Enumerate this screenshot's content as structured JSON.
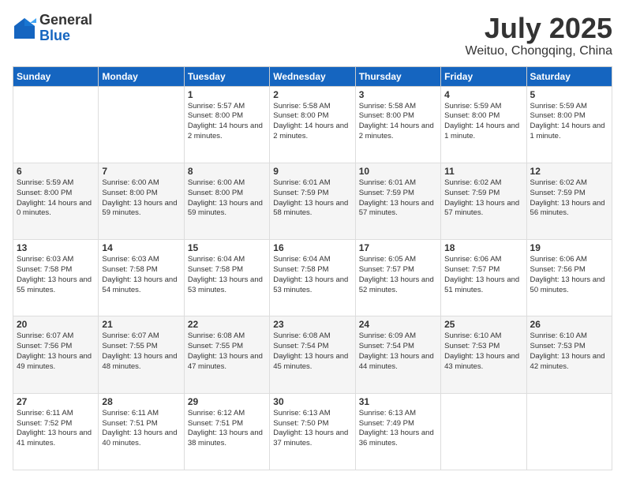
{
  "logo": {
    "general": "General",
    "blue": "Blue"
  },
  "title": "July 2025",
  "location": "Weituo, Chongqing, China",
  "weekdays": [
    "Sunday",
    "Monday",
    "Tuesday",
    "Wednesday",
    "Thursday",
    "Friday",
    "Saturday"
  ],
  "weeks": [
    [
      {
        "day": "",
        "info": ""
      },
      {
        "day": "",
        "info": ""
      },
      {
        "day": "1",
        "info": "Sunrise: 5:57 AM\nSunset: 8:00 PM\nDaylight: 14 hours and 2 minutes."
      },
      {
        "day": "2",
        "info": "Sunrise: 5:58 AM\nSunset: 8:00 PM\nDaylight: 14 hours and 2 minutes."
      },
      {
        "day": "3",
        "info": "Sunrise: 5:58 AM\nSunset: 8:00 PM\nDaylight: 14 hours and 2 minutes."
      },
      {
        "day": "4",
        "info": "Sunrise: 5:59 AM\nSunset: 8:00 PM\nDaylight: 14 hours and 1 minute."
      },
      {
        "day": "5",
        "info": "Sunrise: 5:59 AM\nSunset: 8:00 PM\nDaylight: 14 hours and 1 minute."
      }
    ],
    [
      {
        "day": "6",
        "info": "Sunrise: 5:59 AM\nSunset: 8:00 PM\nDaylight: 14 hours and 0 minutes."
      },
      {
        "day": "7",
        "info": "Sunrise: 6:00 AM\nSunset: 8:00 PM\nDaylight: 13 hours and 59 minutes."
      },
      {
        "day": "8",
        "info": "Sunrise: 6:00 AM\nSunset: 8:00 PM\nDaylight: 13 hours and 59 minutes."
      },
      {
        "day": "9",
        "info": "Sunrise: 6:01 AM\nSunset: 7:59 PM\nDaylight: 13 hours and 58 minutes."
      },
      {
        "day": "10",
        "info": "Sunrise: 6:01 AM\nSunset: 7:59 PM\nDaylight: 13 hours and 57 minutes."
      },
      {
        "day": "11",
        "info": "Sunrise: 6:02 AM\nSunset: 7:59 PM\nDaylight: 13 hours and 57 minutes."
      },
      {
        "day": "12",
        "info": "Sunrise: 6:02 AM\nSunset: 7:59 PM\nDaylight: 13 hours and 56 minutes."
      }
    ],
    [
      {
        "day": "13",
        "info": "Sunrise: 6:03 AM\nSunset: 7:58 PM\nDaylight: 13 hours and 55 minutes."
      },
      {
        "day": "14",
        "info": "Sunrise: 6:03 AM\nSunset: 7:58 PM\nDaylight: 13 hours and 54 minutes."
      },
      {
        "day": "15",
        "info": "Sunrise: 6:04 AM\nSunset: 7:58 PM\nDaylight: 13 hours and 53 minutes."
      },
      {
        "day": "16",
        "info": "Sunrise: 6:04 AM\nSunset: 7:58 PM\nDaylight: 13 hours and 53 minutes."
      },
      {
        "day": "17",
        "info": "Sunrise: 6:05 AM\nSunset: 7:57 PM\nDaylight: 13 hours and 52 minutes."
      },
      {
        "day": "18",
        "info": "Sunrise: 6:06 AM\nSunset: 7:57 PM\nDaylight: 13 hours and 51 minutes."
      },
      {
        "day": "19",
        "info": "Sunrise: 6:06 AM\nSunset: 7:56 PM\nDaylight: 13 hours and 50 minutes."
      }
    ],
    [
      {
        "day": "20",
        "info": "Sunrise: 6:07 AM\nSunset: 7:56 PM\nDaylight: 13 hours and 49 minutes."
      },
      {
        "day": "21",
        "info": "Sunrise: 6:07 AM\nSunset: 7:55 PM\nDaylight: 13 hours and 48 minutes."
      },
      {
        "day": "22",
        "info": "Sunrise: 6:08 AM\nSunset: 7:55 PM\nDaylight: 13 hours and 47 minutes."
      },
      {
        "day": "23",
        "info": "Sunrise: 6:08 AM\nSunset: 7:54 PM\nDaylight: 13 hours and 45 minutes."
      },
      {
        "day": "24",
        "info": "Sunrise: 6:09 AM\nSunset: 7:54 PM\nDaylight: 13 hours and 44 minutes."
      },
      {
        "day": "25",
        "info": "Sunrise: 6:10 AM\nSunset: 7:53 PM\nDaylight: 13 hours and 43 minutes."
      },
      {
        "day": "26",
        "info": "Sunrise: 6:10 AM\nSunset: 7:53 PM\nDaylight: 13 hours and 42 minutes."
      }
    ],
    [
      {
        "day": "27",
        "info": "Sunrise: 6:11 AM\nSunset: 7:52 PM\nDaylight: 13 hours and 41 minutes."
      },
      {
        "day": "28",
        "info": "Sunrise: 6:11 AM\nSunset: 7:51 PM\nDaylight: 13 hours and 40 minutes."
      },
      {
        "day": "29",
        "info": "Sunrise: 6:12 AM\nSunset: 7:51 PM\nDaylight: 13 hours and 38 minutes."
      },
      {
        "day": "30",
        "info": "Sunrise: 6:13 AM\nSunset: 7:50 PM\nDaylight: 13 hours and 37 minutes."
      },
      {
        "day": "31",
        "info": "Sunrise: 6:13 AM\nSunset: 7:49 PM\nDaylight: 13 hours and 36 minutes."
      },
      {
        "day": "",
        "info": ""
      },
      {
        "day": "",
        "info": ""
      }
    ]
  ]
}
